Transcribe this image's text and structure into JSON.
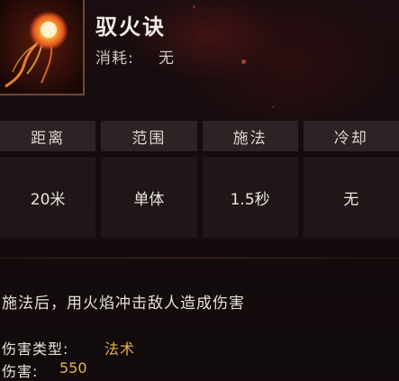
{
  "skill": {
    "name": "驭火诀",
    "cost_label": "消耗:",
    "cost_value": "无",
    "icon": "fire-orb-icon"
  },
  "stats": {
    "headers": [
      "距离",
      "范围",
      "施法",
      "冷却"
    ],
    "values": [
      "20米",
      "单体",
      "1.5秒",
      "无"
    ]
  },
  "description": "施法后，用火焰冲击敌人造成伤害",
  "damage_type": {
    "label": "伤害类型:",
    "value": "法术"
  },
  "damage": {
    "label": "伤害:",
    "value": "550"
  },
  "colors": {
    "highlight": "#e6b34a",
    "background": "#120a0b",
    "header_cell": "#2b2324",
    "value_cell": "#1e1617"
  }
}
